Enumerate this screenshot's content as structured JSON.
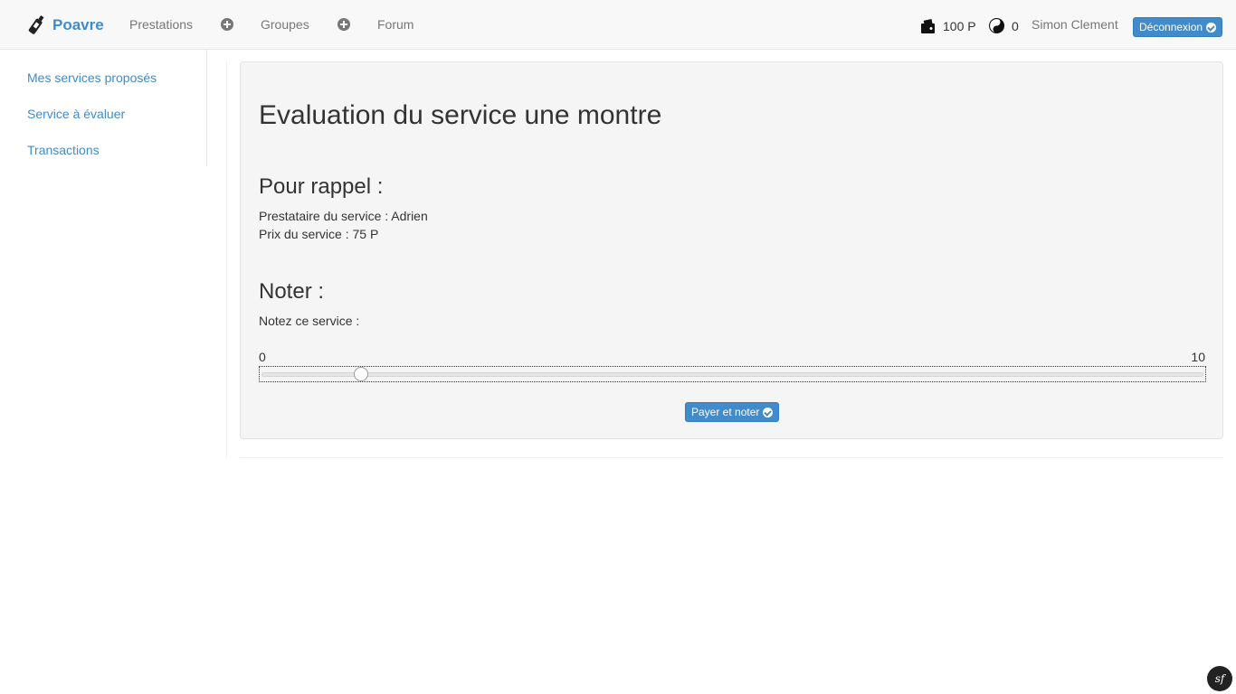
{
  "navbar": {
    "brand": "Poavre",
    "links": [
      "Prestations",
      "Groupes",
      "Forum"
    ],
    "wallet_amount": "100 P",
    "karma_value": "0",
    "user_name": "Simon Clement",
    "logout_label": "Déconnexion"
  },
  "sidebar": {
    "items": [
      {
        "label": "Mes services proposés"
      },
      {
        "label": "Service à évaluer"
      },
      {
        "label": "Transactions"
      }
    ]
  },
  "main": {
    "title": "Evaluation du service une montre",
    "rappel_heading": "Pour rappel :",
    "provider_line": "Prestataire du service : Adrien",
    "price_line": "Prix du service : 75 P",
    "noter_heading": "Noter :",
    "rating_prompt": "Notez ce service :",
    "slider": {
      "min_label": "0",
      "max_label": "10",
      "min": 0,
      "max": 10,
      "value": 1
    },
    "submit_label": "Payer et noter"
  },
  "colors": {
    "primary": "#428bca",
    "navbar_bg": "#f8f8f8",
    "panel_bg": "#f5f5f5"
  },
  "icons": [
    "bottle-logo-icon",
    "plus-circle-icon",
    "wallet-icon",
    "yin-yang-icon",
    "check-circle-icon",
    "symfony-icon"
  ],
  "debug_badge": "sf"
}
